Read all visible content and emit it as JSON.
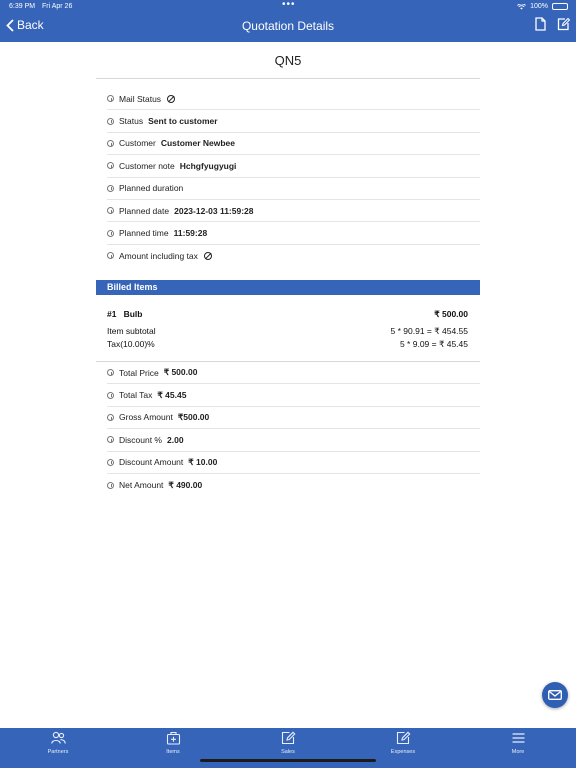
{
  "status_bar": {
    "time": "6:39 PM",
    "date": "Fri Apr 26",
    "battery": "100%"
  },
  "nav": {
    "back_label": "Back",
    "title": "Quotation Details"
  },
  "quotation": {
    "number": "QN5"
  },
  "details": [
    {
      "label": "Mail Status",
      "value": "",
      "icon": "na-icon"
    },
    {
      "label": "Status",
      "value": "Sent to customer"
    },
    {
      "label": "Customer",
      "value": "Customer Newbee"
    },
    {
      "label": "Customer note",
      "value": "Hchgfyugyugi"
    },
    {
      "label": "Planned duration",
      "value": ""
    },
    {
      "label": "Planned date",
      "value": "2023-12-03 11:59:28"
    },
    {
      "label": "Planned time",
      "value": "11:59:28"
    },
    {
      "label": "Amount including tax",
      "value": "",
      "icon": "na-icon"
    }
  ],
  "billed_items": {
    "header": "Billed Items",
    "items": [
      {
        "index": "#1",
        "name": "Bulb",
        "total": "₹ 500.00",
        "subtotal_label": "Item subtotal",
        "subtotal_value": "5 * 90.91 = ₹ 454.55",
        "tax_label": "Tax(10.00)%",
        "tax_value": "5 * 9.09 = ₹ 45.45"
      }
    ]
  },
  "totals": [
    {
      "label": "Total Price",
      "value": "₹ 500.00"
    },
    {
      "label": "Total Tax",
      "value": "₹ 45.45"
    },
    {
      "label": "Gross Amount",
      "value": "₹500.00"
    },
    {
      "label": "Discount %",
      "value": "2.00"
    },
    {
      "label": "Discount Amount",
      "value": "₹ 10.00"
    },
    {
      "label": "Net Amount",
      "value": "₹ 490.00"
    }
  ],
  "tabs": [
    {
      "label": "Partners",
      "icon": "partners-icon"
    },
    {
      "label": "Items",
      "icon": "items-icon"
    },
    {
      "label": "Sales",
      "icon": "sales-icon"
    },
    {
      "label": "Expenses",
      "icon": "expenses-icon"
    },
    {
      "label": "More",
      "icon": "menu-icon"
    }
  ],
  "colors": {
    "primary": "#3564b8",
    "fab": "#2f5fb3"
  }
}
